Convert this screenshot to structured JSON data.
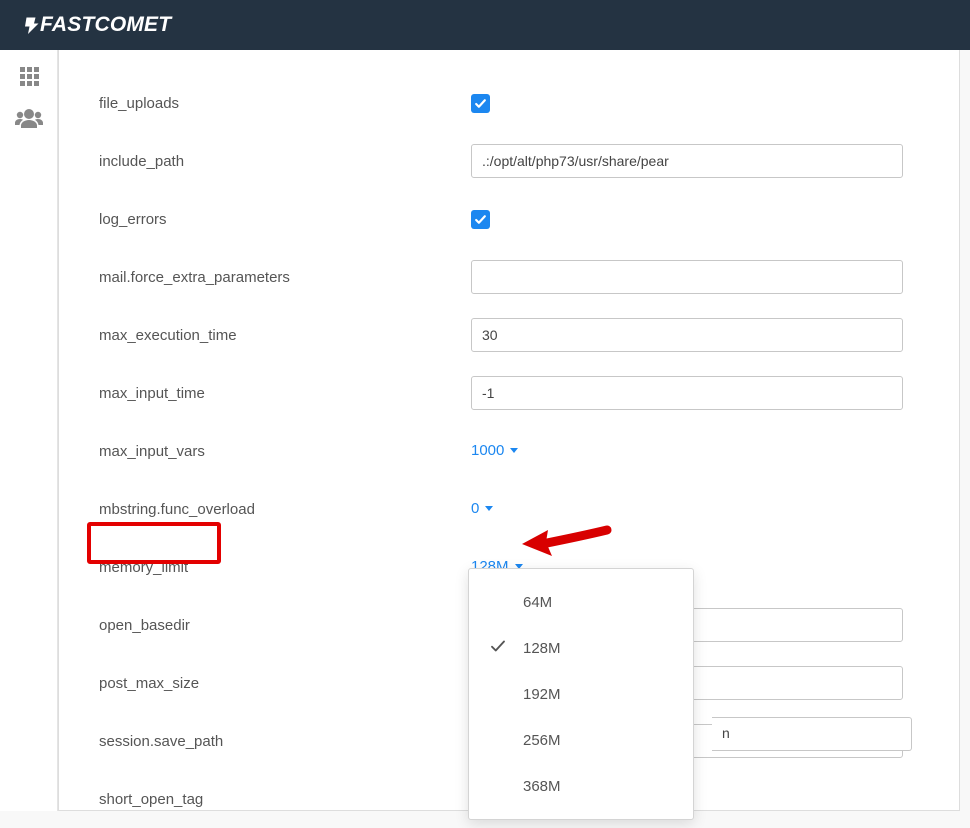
{
  "brand": "FASTCOMET",
  "settings": [
    {
      "id": "file-uploads",
      "label": "file_uploads",
      "type": "checkbox",
      "checked": true
    },
    {
      "id": "include-path",
      "label": "include_path",
      "type": "text",
      "value": ".:/opt/alt/php73/usr/share/pear"
    },
    {
      "id": "log-errors",
      "label": "log_errors",
      "type": "checkbox",
      "checked": true
    },
    {
      "id": "mail-force-extra-parameters",
      "label": "mail.force_extra_parameters",
      "type": "text",
      "value": ""
    },
    {
      "id": "max-execution-time",
      "label": "max_execution_time",
      "type": "text",
      "value": "30"
    },
    {
      "id": "max-input-time",
      "label": "max_input_time",
      "type": "text",
      "value": "-1"
    },
    {
      "id": "max-input-vars",
      "label": "max_input_vars",
      "type": "dropdown",
      "value": "1000"
    },
    {
      "id": "mbstring-func-overload",
      "label": "mbstring.func_overload",
      "type": "dropdown",
      "value": "0"
    },
    {
      "id": "memory-limit",
      "label": "memory_limit",
      "type": "dropdown",
      "value": "128M",
      "highlighted": true,
      "open": true
    },
    {
      "id": "open-basedir",
      "label": "open_basedir",
      "type": "text",
      "value": ""
    },
    {
      "id": "post-max-size",
      "label": "post_max_size",
      "type": "text",
      "value": ""
    },
    {
      "id": "session-save-path",
      "label": "session.save_path",
      "type": "text",
      "value": ""
    },
    {
      "id": "short-open-tag",
      "label": "short_open_tag",
      "type": "dropdown",
      "value": ""
    }
  ],
  "memory_limit_options": [
    {
      "label": "64M",
      "selected": false
    },
    {
      "label": "128M",
      "selected": true
    },
    {
      "label": "192M",
      "selected": false
    },
    {
      "label": "256M",
      "selected": false
    },
    {
      "label": "368M",
      "selected": false
    }
  ],
  "partial_text": "n"
}
